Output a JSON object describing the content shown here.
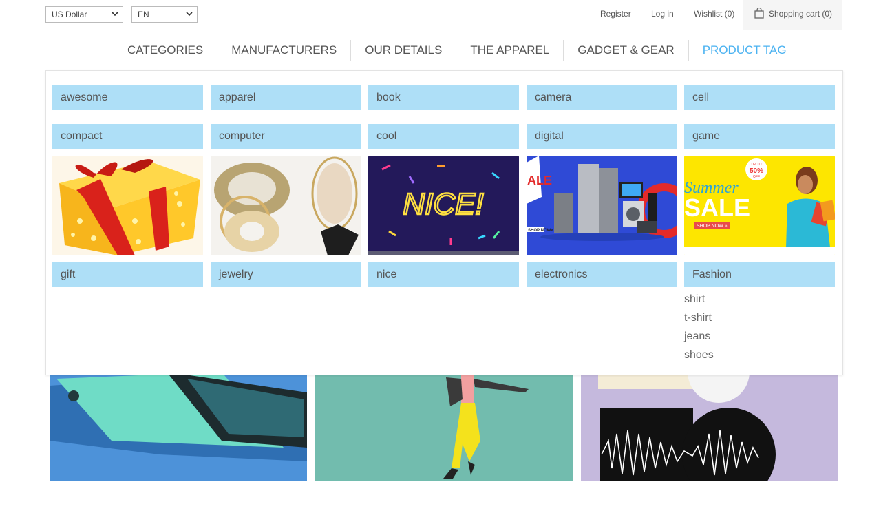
{
  "header": {
    "currency": "US Dollar",
    "language": "EN",
    "links": {
      "register": "Register",
      "login": "Log in",
      "wishlist": "Wishlist (0)"
    },
    "cart": "Shopping cart (0)"
  },
  "nav": {
    "items": [
      "CATEGORIES",
      "MANUFACTURERS",
      "OUR DETAILS",
      "THE APPAREL",
      "GADGET & GEAR",
      "PRODUCT TAG"
    ]
  },
  "tags": {
    "row1": [
      "awesome",
      "apparel",
      "book",
      "camera",
      "cell"
    ],
    "row2": [
      "compact",
      "computer",
      "cool",
      "digital",
      "game"
    ],
    "row3": [
      "gift",
      "jewelry",
      "nice",
      "electronics",
      "Fashion"
    ],
    "fashion_sub": [
      "shirt",
      "t-shirt",
      "jeans",
      "shoes"
    ]
  },
  "images": {
    "nice_text": "NICE!",
    "sale_badge": [
      "UP TO",
      "50%",
      "OFF"
    ],
    "summer": "Summer",
    "sale": "SALE",
    "shop_now": "SHOP NOW »",
    "electronics_sale": "ALE",
    "shop_now_small": "SHOP NOW»"
  },
  "colors": {
    "tag_bg": "#aedff7",
    "accent": "#4ab2f1"
  }
}
